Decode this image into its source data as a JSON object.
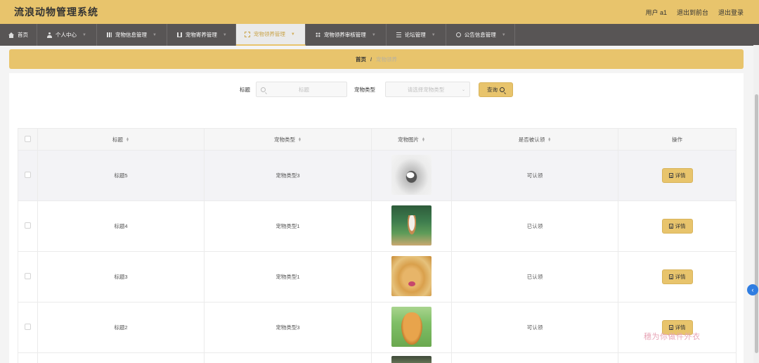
{
  "header": {
    "title": "流浪动物管理系统",
    "user": "用户 a1",
    "back_to_front": "退出到前台",
    "logout": "退出登录"
  },
  "nav": {
    "items": [
      {
        "label": "首页",
        "icon": "home-icon"
      },
      {
        "label": "个人中心",
        "icon": "user-icon"
      },
      {
        "label": "宠物信息管理",
        "icon": "grid-icon"
      },
      {
        "label": "宠物寄养管理",
        "icon": "chart-icon"
      },
      {
        "label": "宠物领养管理",
        "icon": "dashed-square-icon",
        "active": true
      },
      {
        "label": "宠物领养审核管理",
        "icon": "apps-icon"
      },
      {
        "label": "论坛管理",
        "icon": "list-icon"
      },
      {
        "label": "公告信息管理",
        "icon": "clock-icon"
      }
    ]
  },
  "breadcrumb": {
    "home": "首页",
    "separator": "/",
    "current": "宠物领养"
  },
  "search": {
    "title_label": "标题",
    "title_placeholder": "标题",
    "type_label": "宠物类型",
    "type_placeholder": "请选择宠物类型",
    "query_button": "查询"
  },
  "table": {
    "headers": [
      "标题",
      "宠物类型",
      "宠物图片",
      "是否被认领",
      "操作"
    ],
    "rows": [
      {
        "title": "标题5",
        "type": "宠物类型3",
        "image": "husky-photo",
        "status": "可认领",
        "action": "详情"
      },
      {
        "title": "标题4",
        "type": "宠物类型1",
        "image": "corgi-photo",
        "status": "已认领",
        "action": "详情"
      },
      {
        "title": "标题3",
        "type": "宠物类型1",
        "image": "golden-retriever-photo",
        "status": "已认领",
        "action": "详情"
      },
      {
        "title": "标题2",
        "type": "宠物类型3",
        "image": "golden-retriever-grass-photo",
        "status": "可认领",
        "action": "详情"
      }
    ]
  },
  "watermark": "穗为你做件外衣",
  "colors": {
    "primary": "#e8c46c",
    "nav_bg": "#585555",
    "accent_blue": "#2f7de1"
  }
}
